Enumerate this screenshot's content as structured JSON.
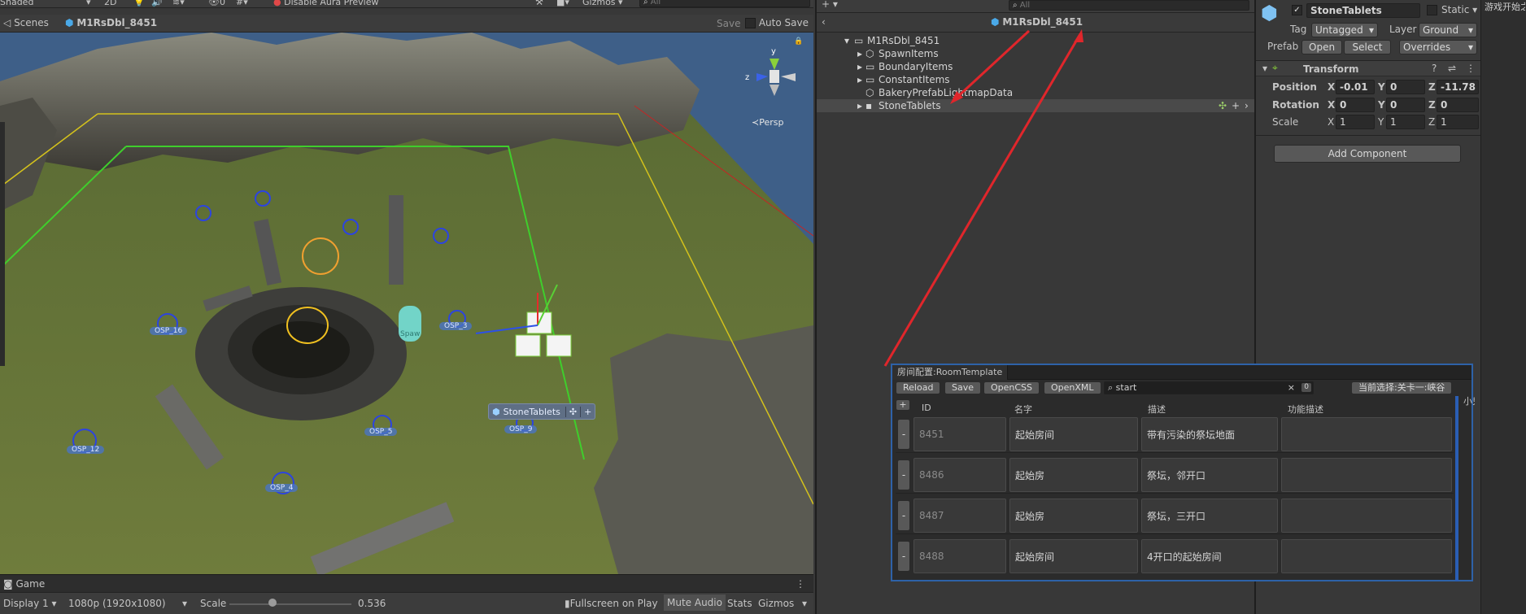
{
  "scene_toolbar": {
    "shading": "Shaded",
    "mode_2d": "2D",
    "effects_count": "0",
    "aura_label": "Disable Aura Preview",
    "gizmos": "Gizmos",
    "search_placeholder": "All"
  },
  "scene_tabs": {
    "scenes_label": "Scenes",
    "prefab_name": "M1RsDbl_8451",
    "save_label": "Save",
    "auto_save_label": "Auto Save"
  },
  "scene_view": {
    "projection": "Persp",
    "axis_y": "y",
    "axis_z": "z",
    "selected_object": "StoneTablets",
    "spawn_labels": [
      "OSP_16",
      "OSP_3",
      "OSP_5",
      "OSP_12",
      "OSP_4",
      "OSP_9",
      "Spaw"
    ]
  },
  "game": {
    "tab_label": "Game",
    "display": "Display 1",
    "resolution": "1080p (1920x1080)",
    "scale_label": "Scale",
    "scale_value": "0.536",
    "fullscreen": "Fullscreen on Play",
    "mute": "Mute Audio",
    "stats": "Stats",
    "gizmos": "Gizmos"
  },
  "hierarchy": {
    "search_placeholder": "All",
    "title": "M1RsDbl_8451",
    "items": [
      {
        "label": "M1RsDbl_8451"
      },
      {
        "label": "SpawnItems"
      },
      {
        "label": "BoundaryItems"
      },
      {
        "label": "ConstantItems"
      },
      {
        "label": "BakeryPrefabLightmapData"
      },
      {
        "label": "StoneTablets"
      }
    ]
  },
  "inspector": {
    "object_name": "StoneTablets",
    "static_label": "Static",
    "tag_label": "Tag",
    "tag_value": "Untagged",
    "layer_label": "Layer",
    "layer_value": "Ground",
    "prefab_label": "Prefab",
    "open_label": "Open",
    "select_label": "Select",
    "overrides_label": "Overrides",
    "transform_title": "Transform",
    "position_label": "Position",
    "rotation_label": "Rotation",
    "scale_label": "Scale",
    "x": "X",
    "y": "Y",
    "z": "Z",
    "position": {
      "x": "-0.01",
      "y": "0",
      "z": "-11.78"
    },
    "rotation": {
      "x": "0",
      "y": "0",
      "z": "0"
    },
    "scale": {
      "x": "1",
      "y": "1",
      "z": "1"
    },
    "add_component": "Add Component"
  },
  "right_strip_text": "游戏开始之",
  "room_template": {
    "tab_title": "房间配置:RoomTemplate",
    "reload": "Reload",
    "save": "Save",
    "open_css": "OpenCSS",
    "open_xml": "OpenXML",
    "search_value": "start",
    "search_clear": "×",
    "count": "0",
    "current_selection": "当前选择:关卡一:峡谷",
    "add_btn": "+",
    "remove_btn": "-",
    "columns": [
      "ID",
      "名字",
      "描述",
      "功能描述",
      "小鬼"
    ],
    "rows": [
      {
        "id": "8451",
        "name": "起始房间",
        "desc": "带有污染的祭坛地面",
        "func": ""
      },
      {
        "id": "8486",
        "name": "起始房",
        "desc": "祭坛，邻开口",
        "func": ""
      },
      {
        "id": "8487",
        "name": "起始房",
        "desc": "祭坛，三开口",
        "func": ""
      },
      {
        "id": "8488",
        "name": "起始房间",
        "desc": "4开口的起始房间",
        "func": ""
      }
    ]
  },
  "colors": {
    "accent_blue": "#2e62a8",
    "arrow_red": "#e0262b",
    "editor_bg": "#383838"
  }
}
